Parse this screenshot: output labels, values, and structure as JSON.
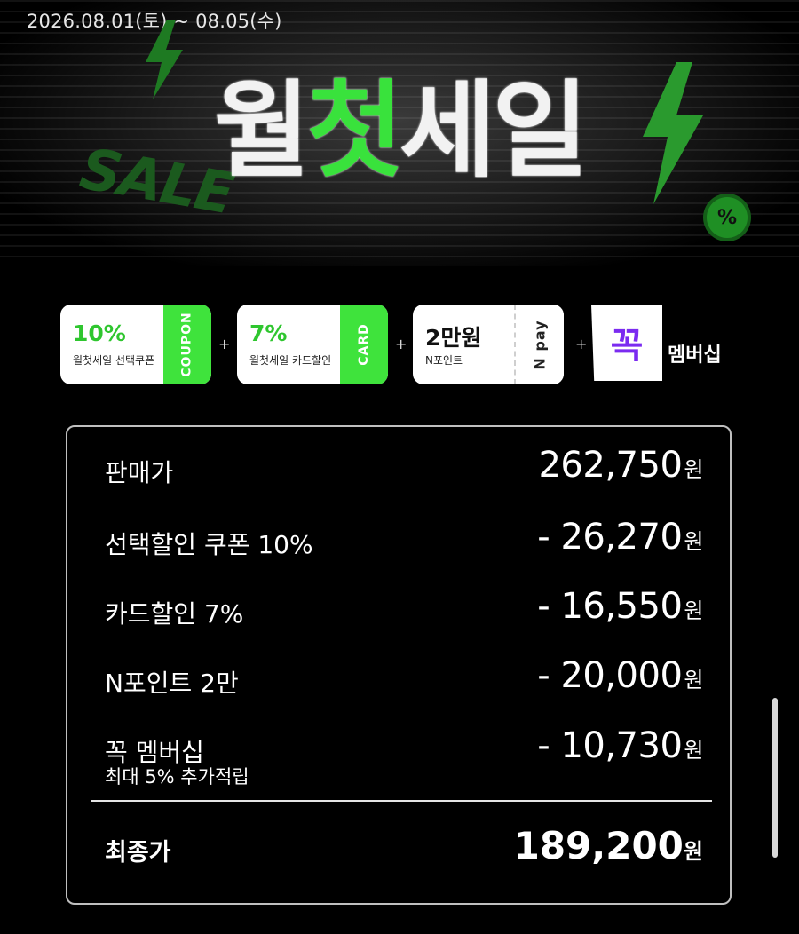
{
  "event": {
    "date_range": "2026.08.01(토) ~ 08.05(수)",
    "title_part1": "월",
    "title_accent": "첫",
    "title_part2": "세일",
    "graffiti": "SALE",
    "badge": "%"
  },
  "benefits": [
    {
      "value": "10%",
      "desc": "월첫세일 선택쿠폰",
      "tag": "COUPON"
    },
    {
      "value": "7%",
      "desc": "월첫세일 카드할인",
      "tag": "CARD"
    },
    {
      "value": "2만원",
      "desc": "N포인트",
      "tag": "N pay"
    }
  ],
  "plus": "+",
  "membership": {
    "logo": "꼭",
    "label": "멤버십"
  },
  "price": {
    "rows": [
      {
        "label": "판매가",
        "value": "262,750"
      },
      {
        "label": "선택할인 쿠폰 10%",
        "value": "- 26,270"
      },
      {
        "label": "카드할인 7%",
        "value": "- 16,550"
      },
      {
        "label": "N포인트 2만",
        "value": "- 20,000"
      },
      {
        "label": "꼭 멤버십",
        "sub": "최대 5% 추가적립",
        "value": "- 10,730"
      }
    ],
    "currency": "원",
    "final_label": "최종가",
    "final_value": "189,200"
  },
  "colors": {
    "accent": "#39e23c",
    "membership": "#7b2bf0",
    "background": "#000000"
  }
}
